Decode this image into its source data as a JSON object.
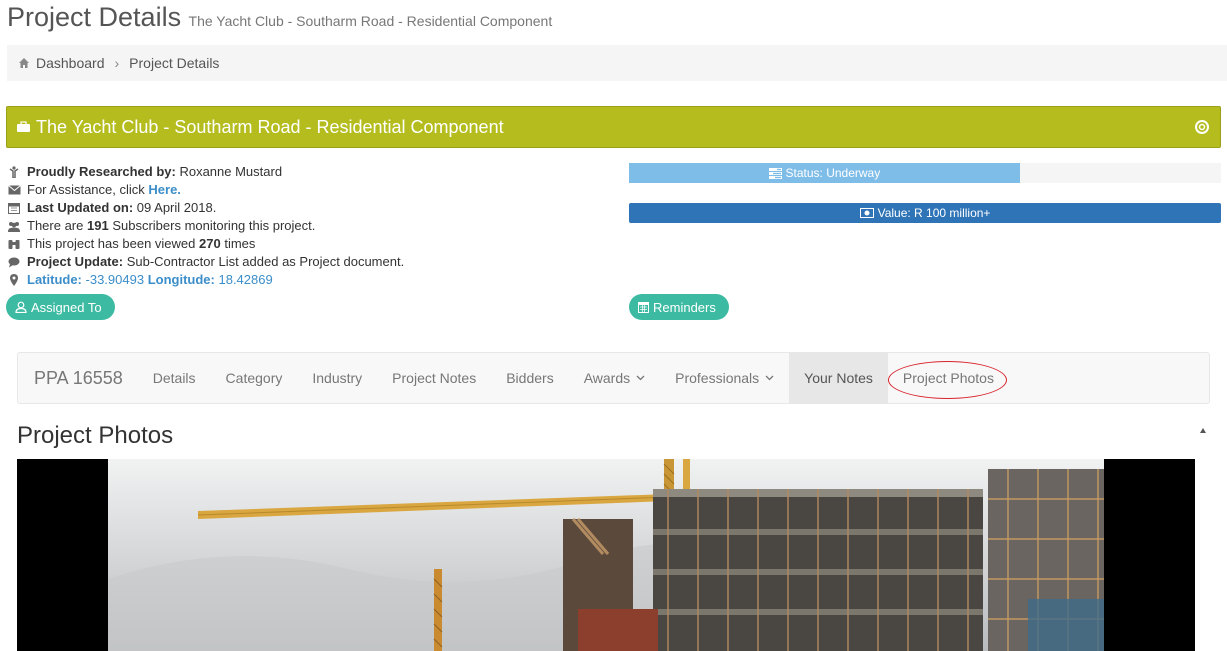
{
  "header": {
    "title": "Project Details",
    "subtitle": "The Yacht Club - Southarm Road - Residential Component"
  },
  "breadcrumb": {
    "items": [
      "Dashboard",
      "Project Details"
    ]
  },
  "banner": {
    "title": "The Yacht Club - Southarm Road - Residential Component",
    "color": "#b5bd1e"
  },
  "info": {
    "researched_label": "Proudly Researched by:",
    "researched_value": "Roxanne Mustard",
    "assistance_text": "For Assistance, click",
    "assistance_link": "Here.",
    "updated_label": "Last Updated on:",
    "updated_value": "09 April 2018.",
    "subscribers_pre": "There are",
    "subscribers_count": "191",
    "subscribers_post": "Subscribers monitoring this project.",
    "views_pre": "This project has been viewed",
    "views_count": "270",
    "views_post": "times",
    "update_label": "Project Update:",
    "update_value": "Sub-Contractor List added as Project document.",
    "latitude_label": "Latitude:",
    "latitude_value": "-33.90493",
    "longitude_label": "Longitude:",
    "longitude_value": "18.42869"
  },
  "buttons": {
    "assigned": "Assigned To",
    "reminders": "Reminders"
  },
  "status": {
    "label": "Status: Underway",
    "progress_fraction": 0.66,
    "color": "#7fbde9"
  },
  "value": {
    "label": "Value: R 100 million+",
    "color": "#2f74b7"
  },
  "nav": {
    "brand": "PPA 16558",
    "items": [
      "Details",
      "Category",
      "Industry",
      "Project Notes",
      "Bidders",
      "Awards",
      "Professionals",
      "Your Notes",
      "Project Photos"
    ],
    "active": "Your Notes",
    "highlighted": "Project Photos"
  },
  "photos": {
    "section_title": "Project Photos"
  }
}
